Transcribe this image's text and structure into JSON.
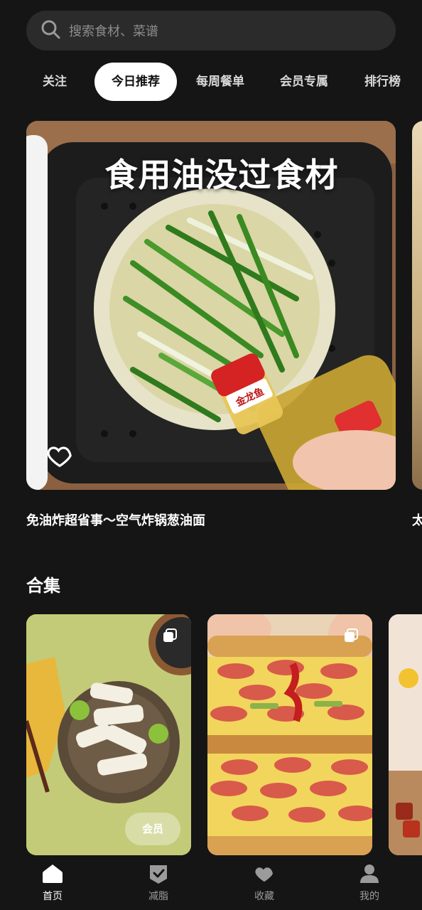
{
  "search": {
    "placeholder": "搜索食材、菜谱"
  },
  "tabs": [
    {
      "label": "关注",
      "active": false
    },
    {
      "label": "今日推荐",
      "active": true
    },
    {
      "label": "每周餐单",
      "active": false
    },
    {
      "label": "会员专属",
      "active": false
    },
    {
      "label": "排行榜",
      "active": false
    }
  ],
  "featured": {
    "overlay_text": "食用油没过食材",
    "bottle_label": "金龙鱼",
    "caption": "免油炸超省事～空气炸锅葱油面",
    "next_caption_partial": "太"
  },
  "collections": {
    "title": "合集",
    "items": [
      {
        "name": "chicken-dish",
        "badge": "会员"
      },
      {
        "name": "sausage-sandwich"
      },
      {
        "name": "jelly-dessert"
      }
    ]
  },
  "nav": [
    {
      "label": "首页",
      "icon": "home-icon",
      "active": true
    },
    {
      "label": "减脂",
      "icon": "diet-check-icon",
      "active": false
    },
    {
      "label": "收藏",
      "icon": "heart-icon",
      "active": false
    },
    {
      "label": "我的",
      "icon": "user-icon",
      "active": false
    }
  ],
  "colors": {
    "background": "#151515",
    "search_bg": "#2b2b2b",
    "active_tab_bg": "#ffffff",
    "nav_inactive": "#9b9b9b"
  }
}
